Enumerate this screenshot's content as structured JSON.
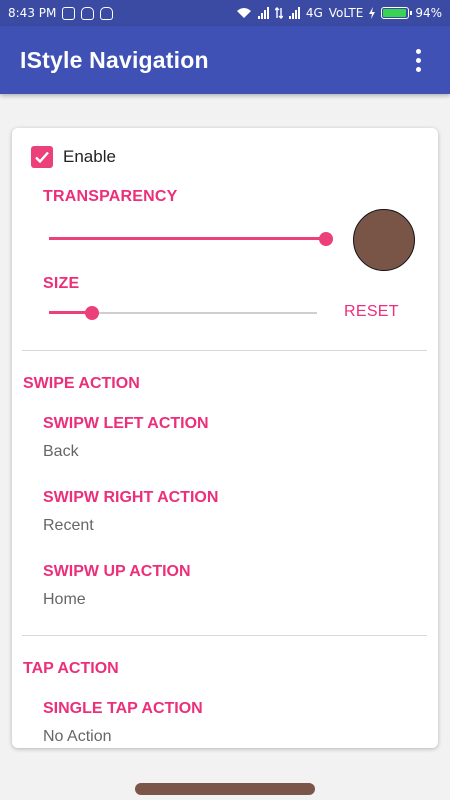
{
  "status_bar": {
    "time": "8:43 PM",
    "network_type": "4G",
    "volte_label": "VoLTE",
    "battery_percent": "94%",
    "battery_level": 0.94,
    "battery_color": "#39d353"
  },
  "app_bar": {
    "title": "IStyle Navigation",
    "color": "#3f51b5",
    "overflow_icon": "more-vert-icon"
  },
  "general": {
    "enable_label": "Enable",
    "enable_checked": true,
    "transparency_label": "TRANSPARENCY",
    "transparency_value": 1.0,
    "size_label": "SIZE",
    "size_value": 0.16,
    "reset_label": "RESET",
    "preview_color": "#795548",
    "accent_color": "#ec407a"
  },
  "swipe": {
    "section_title": "SWIPE ACTION",
    "items": [
      {
        "title": "SWIPW LEFT ACTION",
        "value": "Back"
      },
      {
        "title": "SWIPW RIGHT ACTION",
        "value": "Recent"
      },
      {
        "title": "SWIPW UP ACTION",
        "value": "Home"
      }
    ]
  },
  "tap": {
    "section_title": "TAP ACTION",
    "items": [
      {
        "title": "SINGLE TAP ACTION",
        "value": "No Action"
      }
    ]
  }
}
